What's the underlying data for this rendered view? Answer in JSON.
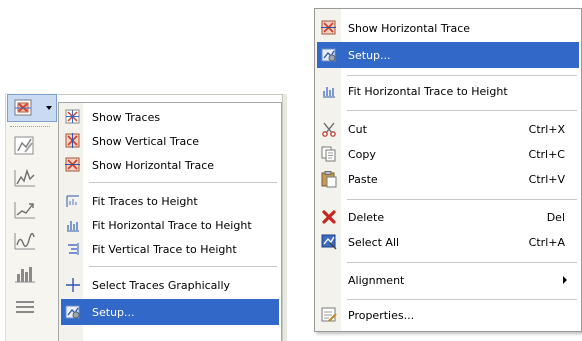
{
  "left_menu": {
    "items": [
      {
        "label": "Show Traces",
        "icon": "traces-icon"
      },
      {
        "label": "Show Vertical Trace",
        "icon": "vertical-trace-icon"
      },
      {
        "label": "Show Horizontal Trace",
        "icon": "horizontal-trace-icon"
      },
      {
        "label": "Fit Traces to Height",
        "icon": "fit-traces-icon"
      },
      {
        "label": "Fit Horizontal Trace to Height",
        "icon": "fit-horizontal-icon"
      },
      {
        "label": "Fit Vertical Trace to Height",
        "icon": "fit-vertical-icon"
      },
      {
        "label": "Select Traces Graphically",
        "icon": "crosshair-icon"
      },
      {
        "label": "Setup...",
        "icon": "setup-icon",
        "selected": true
      }
    ]
  },
  "right_menu": {
    "items": [
      {
        "label": "Show Horizontal Trace",
        "shortcut": "",
        "icon": "horizontal-trace-icon"
      },
      {
        "label": "Setup...",
        "shortcut": "",
        "icon": "setup-icon",
        "selected": true
      },
      {
        "label": "Fit Horizontal Trace to Height",
        "shortcut": "",
        "icon": "fit-horizontal-icon"
      },
      {
        "label": "Cut",
        "shortcut": "Ctrl+X",
        "icon": "scissors-icon"
      },
      {
        "label": "Copy",
        "shortcut": "Ctrl+C",
        "icon": "copy-icon"
      },
      {
        "label": "Paste",
        "shortcut": "Ctrl+V",
        "icon": "paste-icon"
      },
      {
        "label": "Delete",
        "shortcut": "Del",
        "icon": "delete-icon"
      },
      {
        "label": "Select All",
        "shortcut": "Ctrl+A",
        "icon": "select-all-icon"
      },
      {
        "label": "Alignment",
        "shortcut": "",
        "icon": "",
        "submenu": true
      },
      {
        "label": "Properties...",
        "shortcut": "",
        "icon": "properties-icon"
      }
    ]
  },
  "colors": {
    "selection": "#3268c8",
    "gutter": "#f3f2ec",
    "toolbar_button_active": "#c9daf3"
  }
}
